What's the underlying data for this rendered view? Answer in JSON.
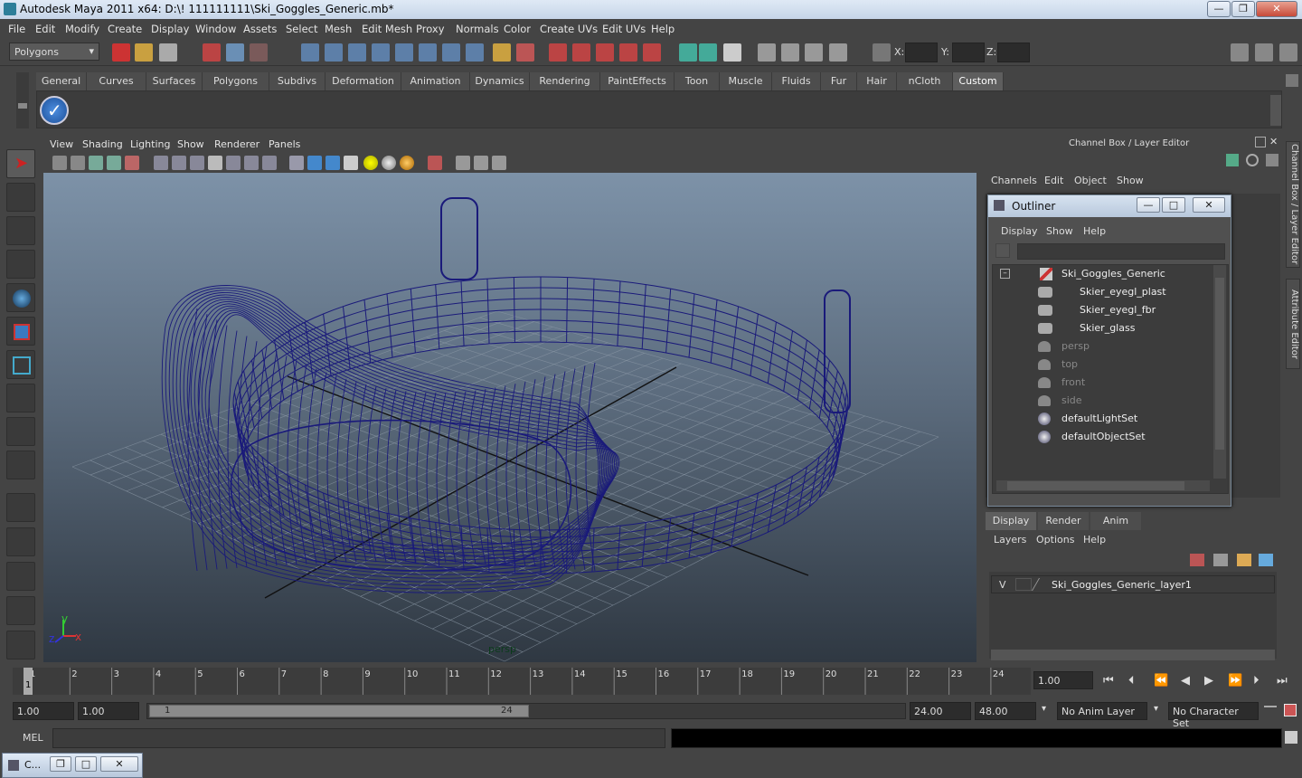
{
  "window": {
    "title": "Autodesk Maya 2011 x64: D:\\! 111111111\\Ski_Goggles_Generic.mb*",
    "minimize": "—",
    "restore": "❐",
    "close": "✕"
  },
  "menubar": [
    "File",
    "Edit",
    "Modify",
    "Create",
    "Display",
    "Window",
    "Assets",
    "Select",
    "Mesh",
    "Edit Mesh",
    "Proxy",
    "Normals",
    "Color",
    "Create UVs",
    "Edit UVs",
    "Help"
  ],
  "statusline": {
    "mode": "Polygons",
    "x_label": "X:",
    "y_label": "Y:",
    "z_label": "Z:"
  },
  "shelf": {
    "tabs": [
      "General",
      "Curves",
      "Surfaces",
      "Polygons",
      "Subdivs",
      "Deformation",
      "Animation",
      "Dynamics",
      "Rendering",
      "PaintEffects",
      "Toon",
      "Muscle",
      "Fluids",
      "Fur",
      "Hair",
      "nCloth",
      "Custom"
    ],
    "active_tab": "Custom"
  },
  "panel": {
    "menus": [
      "View",
      "Shading",
      "Lighting",
      "Show",
      "Renderer",
      "Panels"
    ],
    "camera_label": "persp",
    "axis_x": "x",
    "axis_y": "y",
    "axis_z": "z"
  },
  "right_panel": {
    "header": "Channel Box / Layer Editor",
    "menus": [
      "Channels",
      "Edit",
      "Object",
      "Show"
    ],
    "side_tab_1": "Channel Box / Layer Editor",
    "side_tab_2": "Attribute Editor"
  },
  "outliner": {
    "title": "Outliner",
    "menus": [
      "Display",
      "Show",
      "Help"
    ],
    "items": [
      {
        "label": "Ski_Goggles_Generic",
        "dim": false
      },
      {
        "label": "Skier_eyegl_plast",
        "dim": false
      },
      {
        "label": "Skier_eyegl_fbr",
        "dim": false
      },
      {
        "label": "Skier_glass",
        "dim": false
      },
      {
        "label": "persp",
        "dim": true
      },
      {
        "label": "top",
        "dim": true
      },
      {
        "label": "front",
        "dim": true
      },
      {
        "label": "side",
        "dim": true
      },
      {
        "label": "defaultLightSet",
        "dim": false
      },
      {
        "label": "defaultObjectSet",
        "dim": false
      }
    ]
  },
  "layer_editor": {
    "tabs": [
      "Display",
      "Render",
      "Anim"
    ],
    "active_tab": "Display",
    "menus": [
      "Layers",
      "Options",
      "Help"
    ],
    "layer_visible": "V",
    "layer_name": "Ski_Goggles_Generic_layer1"
  },
  "timeline": {
    "ticks": [
      "1",
      "2",
      "3",
      "4",
      "5",
      "6",
      "7",
      "8",
      "9",
      "10",
      "11",
      "12",
      "13",
      "14",
      "15",
      "16",
      "17",
      "18",
      "19",
      "20",
      "21",
      "22",
      "23",
      "24"
    ],
    "current_frame": "1",
    "current_time": "1.00"
  },
  "range": {
    "start": "1.00",
    "start_playback": "1.00",
    "slider_start": "1",
    "slider_end": "24",
    "end_playback": "24.00",
    "end": "48.00",
    "anim_layer": "No Anim Layer",
    "character_set": "No Character Set"
  },
  "cmdline": {
    "label": "MEL"
  },
  "taskbar": {
    "item": "C..."
  },
  "colors": {
    "wireframe": "#1a1a7a",
    "viewport_top": "#7d92a8",
    "viewport_bottom": "#2f3842",
    "active_tab": "#5e5e5e"
  }
}
